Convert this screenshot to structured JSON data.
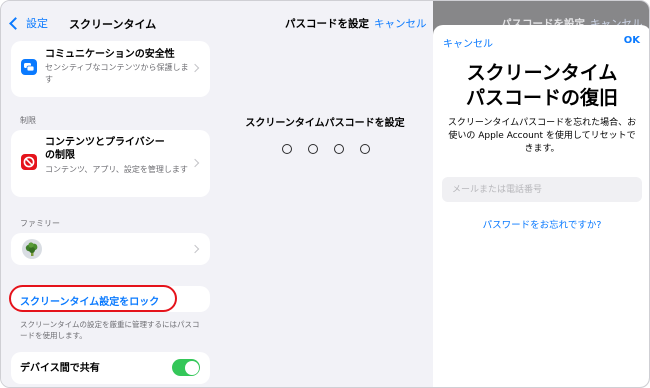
{
  "left": {
    "back_label": "設定",
    "title": "スクリーンタイム",
    "communication": {
      "title": "コミュニケーションの安全性",
      "subtitle": "センシティブなコンテンツから保護します",
      "icon": "chat-bubbles-icon",
      "icon_color": "#0a7aff"
    },
    "restrictions": {
      "section_label": "制限",
      "title_line1": "コンテンツとプライバシー",
      "title_line2": "の制限",
      "subtitle": "コンテンツ、アプリ、設定を管理します",
      "icon": "no-entry-icon",
      "icon_color": "#e5131b"
    },
    "family": {
      "section_label": "ファミリー",
      "avatar": "broccoli-memoji-avatar"
    },
    "lock": {
      "label": "スクリーンタイム設定をロック",
      "note": "スクリーンタイムの設定を厳重に管理するにはパスコードを使用します。",
      "highlight_color": "#e5131b"
    },
    "share": {
      "label": "デバイス間で共有",
      "toggle_on": true,
      "toggle_color": "#34c759"
    }
  },
  "middle": {
    "title": "パスコードを設定",
    "cancel": "キャンセル",
    "prompt": "スクリーンタイムパスコードを設定",
    "dot_count": 4
  },
  "dimmed_header": {
    "title": "パスコードを設定",
    "cancel": "キャンセル"
  },
  "sheet": {
    "cancel": "キャンセル",
    "ok": "OK",
    "heading_line1": "スクリーンタイム",
    "heading_line2": "パスコードの復旧",
    "description": "スクリーンタイムパスコードを忘れた場合、お使いの Apple Account を使用してリセットできます。",
    "input_placeholder": "メールまたは電話番号",
    "forgot_link": "パスワードをお忘れですか?"
  }
}
